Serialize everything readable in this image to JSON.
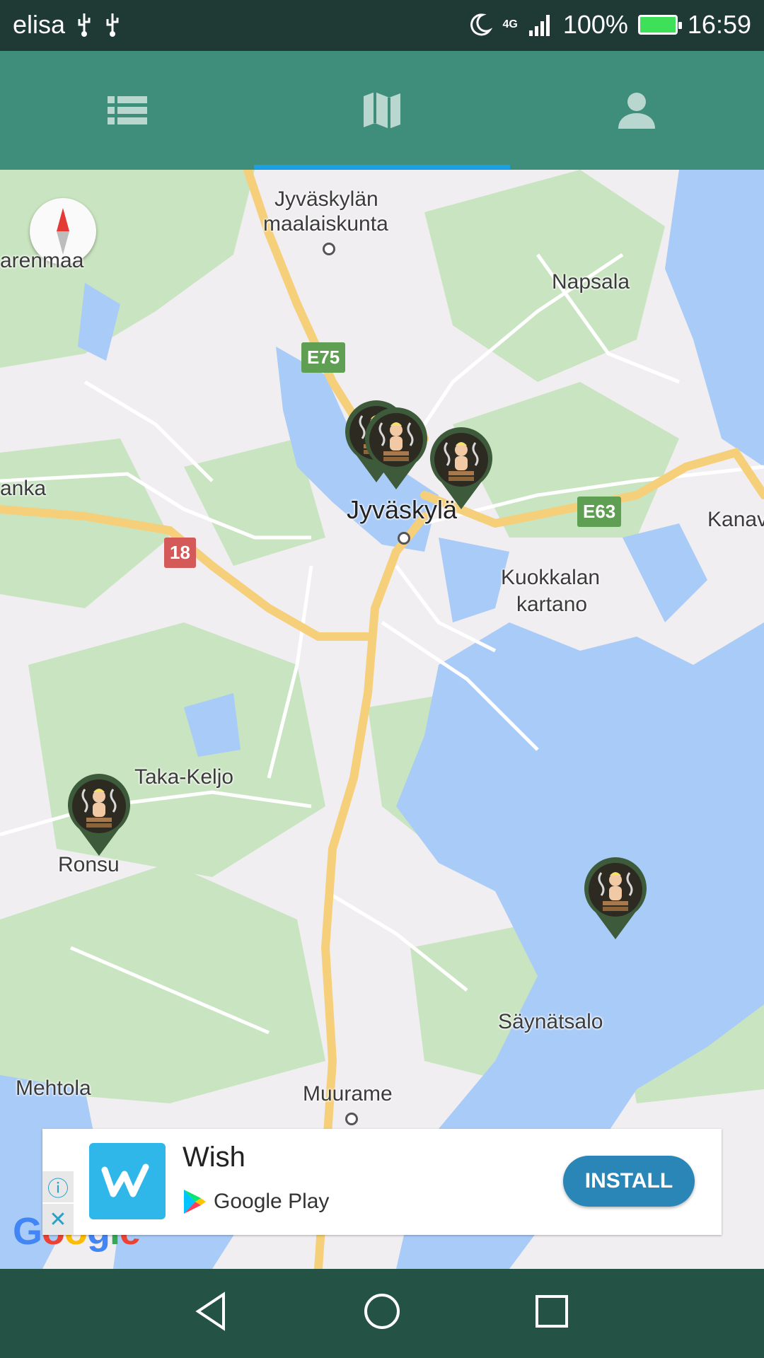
{
  "status_bar": {
    "carrier": "elisa",
    "network": "4G",
    "battery": "100%",
    "time": "16:59",
    "icons": [
      "usb-icon",
      "usb-icon",
      "moon-icon",
      "signal-icon",
      "battery-icon"
    ]
  },
  "tabs": [
    {
      "name": "list",
      "icon": "list-icon",
      "selected": false
    },
    {
      "name": "map",
      "icon": "map-icon",
      "selected": true
    },
    {
      "name": "profile",
      "icon": "person-icon",
      "selected": false
    }
  ],
  "map": {
    "places": {
      "jyvaskylan_mlk_1": "Jyväskylän",
      "jyvaskylan_mlk_2": "maalaiskunta",
      "napsala": "Napsala",
      "arenmaa": "arenmaa",
      "anka": "anka",
      "jyvaskyla": "Jyväskylä",
      "kanav": "Kanav",
      "kuokkalan_1": "Kuokkalan",
      "kuokkalan_2": "kartano",
      "taka_keljo": "Taka-Keljo",
      "ronsu": "Ronsu",
      "saynatsalo": "Säynätsalo",
      "mehtola": "Mehtola",
      "muurame": "Muurame"
    },
    "road_shields": {
      "e75": "E75",
      "e63": "E63",
      "r18": "18"
    },
    "markers": 5,
    "attribution": "Google"
  },
  "ad": {
    "title": "Wish",
    "store": "Google Play",
    "cta": "INSTALL",
    "adchoices_icon": "ad-choices-icon",
    "close_icon": "close-icon"
  },
  "nav_bar": {
    "icons": [
      "back-icon",
      "home-icon",
      "recents-icon"
    ]
  }
}
